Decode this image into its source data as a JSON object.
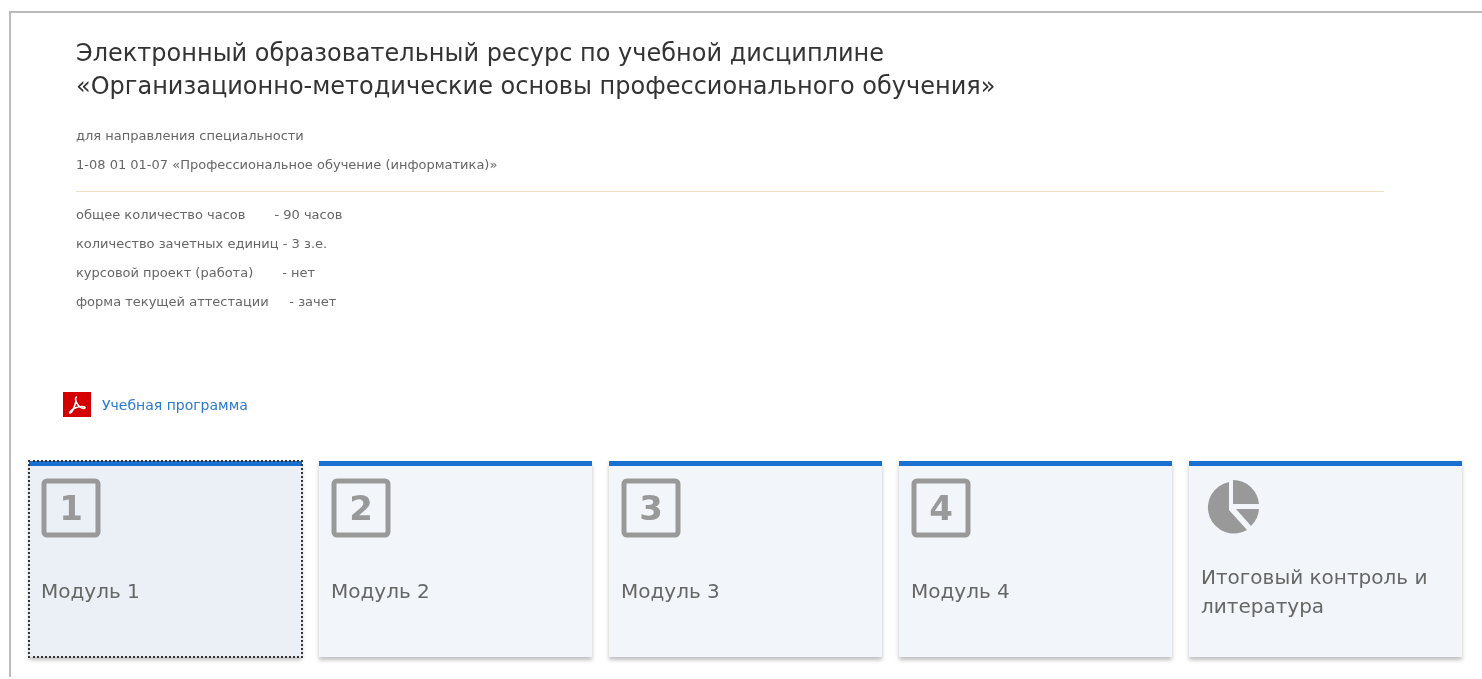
{
  "title_lines": [
    "Электронный образовательный ресурс по учебной дисциплине",
    "«Организационно-методические основы профессионального обучения»"
  ],
  "subtitle_lines": [
    "для направления специальности",
    "1-08 01 01-07  «Профессиональное обучение (информатика)»"
  ],
  "stats": [
    "общее количество часов       - 90 часов",
    "количество зачетных единиц - 3 з.е.",
    "курсовой проект (работа)       - нет",
    "форма текущей аттестации     - зачет"
  ],
  "program_link": {
    "label": "Учебная программа"
  },
  "cards": [
    {
      "kind": "number",
      "icon_text": "1",
      "label": "Модуль 1",
      "selected": true
    },
    {
      "kind": "number",
      "icon_text": "2",
      "label": "Модуль 2",
      "selected": false
    },
    {
      "kind": "number",
      "icon_text": "3",
      "label": "Модуль 3",
      "selected": false
    },
    {
      "kind": "number",
      "icon_text": "4",
      "label": "Модуль 4",
      "selected": false
    },
    {
      "kind": "pie",
      "label": "Итоговый контроль и литература",
      "selected": false
    }
  ]
}
